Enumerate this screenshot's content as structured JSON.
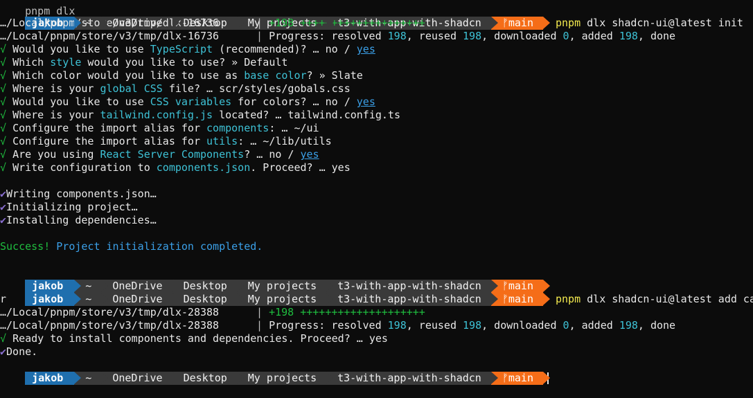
{
  "prompt": {
    "user": "jakob",
    "home": "~",
    "path": [
      "OneDrive",
      "Desktop",
      "My projects",
      "t3-with-app-with-shadcn"
    ],
    "branch": "main",
    "branch_icon": "git-branch-icon"
  },
  "cmd1": {
    "bin": "pnpm",
    "args": "dlx shadcn-ui@latest init"
  },
  "cmd2": {
    "bin": "pnpm",
    "args": "dlx shadcn-ui@latest add calenda"
  },
  "cmd2_wrap": "r",
  "dlx1": {
    "left1": "…/Local/pnpm/store/v3/tmp/dlx-16736",
    "right1a": "+198",
    "right1b": " ++++++++++++++++++++",
    "left2": "…/Local/pnpm/store/v3/tmp/dlx-16736",
    "progress": {
      "label": "Progress: resolved ",
      "resolved": "198",
      "reused_label": ", reused ",
      "reused": "198",
      "downloaded_label": ", downloaded ",
      "downloaded": "0",
      "added_label": ", added ",
      "added": "198",
      "done": ", done"
    }
  },
  "dlx2": {
    "left1": "…/Local/pnpm/store/v3/tmp/dlx-28388",
    "right1a": "+198",
    "right1b": " ++++++++++++++++++++",
    "left2": "…/Local/pnpm/store/v3/tmp/dlx-28388",
    "progress": {
      "label": "Progress: resolved ",
      "resolved": "198",
      "reused_label": ", reused ",
      "reused": "198",
      "downloaded_label": ", downloaded ",
      "downloaded": "0",
      "added_label": ", added ",
      "added": "198",
      "done": ", done"
    }
  },
  "questions": [
    {
      "mark": "√",
      "a": "Would you like to use ",
      "b": "TypeScript",
      "c": " (recommended)? … no / ",
      "d": "yes"
    },
    {
      "mark": "√",
      "a": "Which ",
      "b": "style",
      "c": " would you like to use? » Default",
      "d": ""
    },
    {
      "mark": "√",
      "a": "Which color would you like to use as ",
      "b": "base color",
      "c": "? » Slate",
      "d": ""
    },
    {
      "mark": "√",
      "a": "Where is your ",
      "b": "global CSS",
      "c": " file? … scr/styles/gobals.css",
      "d": ""
    },
    {
      "mark": "√",
      "a": "Would you like to use ",
      "b": "CSS variables",
      "c": " for colors? … no / ",
      "d": "yes"
    },
    {
      "mark": "√",
      "a": "Where is your ",
      "b": "tailwind.config.js",
      "c": " located? … tailwind.config.ts",
      "d": ""
    },
    {
      "mark": "√",
      "a": "Configure the import alias for ",
      "b": "components",
      "c": ": … ~/ui",
      "d": ""
    },
    {
      "mark": "√",
      "a": "Configure the import alias for ",
      "b": "utils",
      "c": ": … ~/lib/utils",
      "d": ""
    },
    {
      "mark": "√",
      "a": "Are you using ",
      "b": "React Server Components",
      "c": "? … no / ",
      "d": "yes"
    },
    {
      "mark": "√",
      "a": "Write configuration to ",
      "b": "components.json",
      "c": ". Proceed? … yes",
      "d": ""
    }
  ],
  "steps": [
    "Writing components.json…",
    "Initializing project…",
    "Installing dependencies…"
  ],
  "success": {
    "a": "Success!",
    "b": " Project initialization completed."
  },
  "ready": {
    "mark": "√",
    "text": "Ready to install components and dependencies. Proceed? … yes"
  },
  "done": "Done.",
  "colors": {
    "user_bg": "#1f6fae",
    "path_bg": "#3a3a3a",
    "git_bg": "#f56d18",
    "accent_blue": "#3ba0e8",
    "success_green": "#1fbd3f",
    "cmd_yellow": "#f2e94e"
  }
}
